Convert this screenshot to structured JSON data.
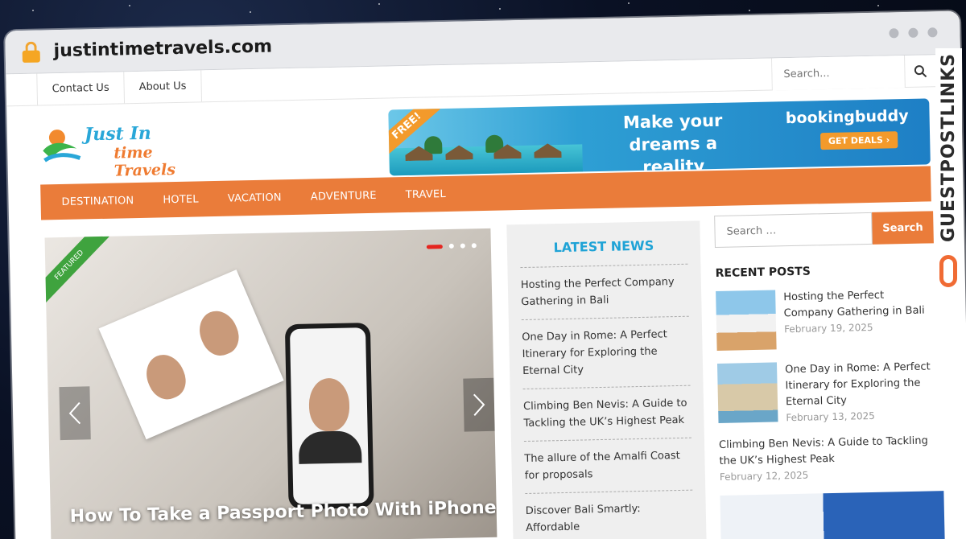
{
  "browser": {
    "url": "justintimetravels.com"
  },
  "topbar": {
    "nav": [
      "Contact Us",
      "About Us"
    ],
    "search_placeholder": "Search..."
  },
  "header": {
    "logo_line1": "Just In",
    "logo_line2": "time Travels",
    "banner": {
      "badge": "FREE!",
      "tagline": "Make your dreams a reality",
      "brand": "bookingbuddy",
      "cta": "GET DEALS ›"
    }
  },
  "mainnav": [
    "DESTINATION",
    "HOTEL",
    "VACATION",
    "ADVENTURE",
    "TRAVEL"
  ],
  "slider": {
    "ribbon": "FEATURED",
    "caption": "How To Take a Passport Photo With iPhone"
  },
  "latest_news": {
    "title": "LATEST NEWS",
    "items": [
      "Hosting the Perfect Company Gathering in Bali",
      "One Day in Rome: A Perfect Itinerary for Exploring the Eternal City",
      "Climbing Ben Nevis: A Guide to Tackling the UK’s Highest Peak",
      "The allure of the Amalfi Coast for proposals",
      "Discover Bali Smartly: Affordable"
    ]
  },
  "sidebar": {
    "search_placeholder": "Search …",
    "search_button": "Search",
    "recent_title": "RECENT POSTS",
    "posts": [
      {
        "title": "Hosting the Perfect Company Gathering in Bali",
        "date": "February 19, 2025"
      },
      {
        "title": "One Day in Rome: A Perfect Itinerary for Exploring the Eternal City",
        "date": "February 13, 2025"
      },
      {
        "title": "Climbing Ben Nevis: A Guide to Tackling the UK’s Highest Peak",
        "date": "February 12, 2025"
      }
    ]
  },
  "watermark": "GUESTPOSTLINKS",
  "colors": {
    "accent": "#ea7c3a",
    "link_blue": "#1fa3d6",
    "featured_green": "#3fa33e"
  }
}
